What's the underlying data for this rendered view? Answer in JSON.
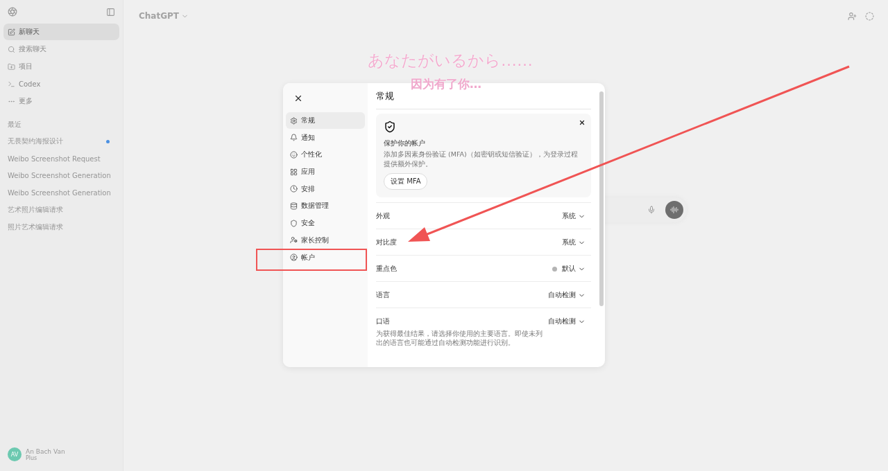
{
  "sidebar": {
    "nav": [
      {
        "label": "新聊天",
        "selected": true
      },
      {
        "label": "搜索聊天",
        "selected": false
      },
      {
        "label": "项目",
        "selected": false
      },
      {
        "label": "Codex",
        "selected": false
      },
      {
        "label": "更多",
        "selected": false
      }
    ],
    "section_title": "最近",
    "chats": [
      {
        "label": "无畏契约海报设计",
        "unread": true
      },
      {
        "label": "Weibo Screenshot Request",
        "unread": false
      },
      {
        "label": "Weibo Screenshot Generation",
        "unread": false
      },
      {
        "label": "Weibo Screenshot Generation",
        "unread": false
      },
      {
        "label": "艺术照片编辑请求",
        "unread": false
      },
      {
        "label": "照片艺术编辑请求",
        "unread": false
      }
    ],
    "user": {
      "initials": "AV",
      "name": "An Bach Van",
      "plan": "Plus"
    }
  },
  "header": {
    "title": "ChatGPT"
  },
  "annotations": {
    "japanese": "あなたがいるから……",
    "chinese": "因为有了你…"
  },
  "settings": {
    "nav": [
      {
        "label": "常规",
        "selected": true
      },
      {
        "label": "通知",
        "selected": false
      },
      {
        "label": "个性化",
        "selected": false
      },
      {
        "label": "应用",
        "selected": false
      },
      {
        "label": "安排",
        "selected": false
      },
      {
        "label": "数据管理",
        "selected": false
      },
      {
        "label": "安全",
        "selected": false
      },
      {
        "label": "家长控制",
        "selected": false
      },
      {
        "label": "帐户",
        "selected": false
      }
    ],
    "heading": "常规",
    "card": {
      "title": "保护你的帐户",
      "description": "添加多因素身份验证 (MFA)（如密钥或短信验证），为登录过程提供额外保护。",
      "button": "设置 MFA"
    },
    "rows": [
      {
        "label": "外观",
        "value": "系统"
      },
      {
        "label": "对比度",
        "value": "系统"
      },
      {
        "label": "重点色",
        "value": "默认",
        "color": "#b4b4b4"
      },
      {
        "label": "语言",
        "value": "自动检测"
      },
      {
        "label": "口语",
        "value": "自动检测",
        "note": "为获得最佳结果，请选择你使用的主要语言。即使未列出的语言也可能通过自动检测功能进行识别。"
      }
    ]
  }
}
